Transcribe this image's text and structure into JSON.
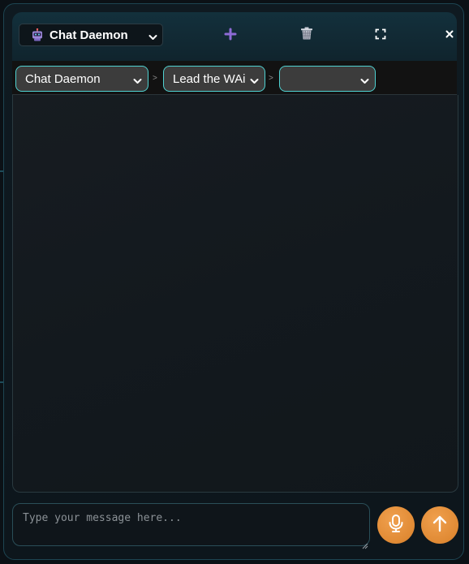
{
  "header": {
    "daemon_select": {
      "label": "Chat Daemon",
      "icon": "robot-icon"
    },
    "buttons": [
      {
        "name": "add-button",
        "icon": "plus-icon",
        "color": "#8e6bd6"
      },
      {
        "name": "delete-button",
        "icon": "trash-icon",
        "color": "#c9ccd6"
      },
      {
        "name": "fullscreen-button",
        "icon": "expand-icon",
        "color": "#ffffff"
      },
      {
        "name": "close-button",
        "icon": "close-icon",
        "color": "#ffffff"
      }
    ]
  },
  "breadcrumb": {
    "items": [
      {
        "label": "Chat Daemon"
      },
      {
        "label": "Lead the WAi"
      },
      {
        "label": ""
      }
    ],
    "separator": ">"
  },
  "composer": {
    "placeholder": "Type your message here...",
    "value": "",
    "mic_icon": "microphone-icon",
    "send_icon": "arrow-up-icon"
  },
  "colors": {
    "accent_cyan": "#4fd1d1",
    "button_orange": "#e08a34",
    "header_bg": "#13303c"
  }
}
